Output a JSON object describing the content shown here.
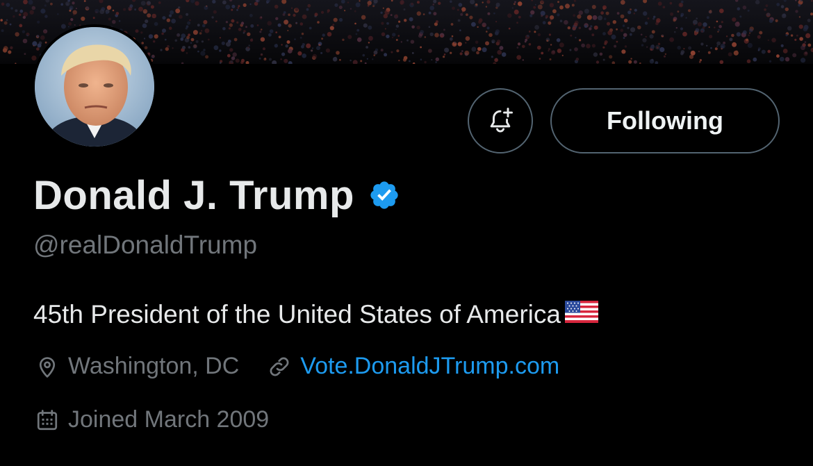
{
  "profile": {
    "display_name": "Donald J. Trump",
    "handle": "@realDonaldTrump",
    "bio": "45th President of the United States of America",
    "bio_emoji": "flag-us-icon",
    "location": "Washington, DC",
    "website": "Vote.DonaldJTrump.com",
    "joined": "Joined March 2009",
    "verified": true
  },
  "actions": {
    "follow_label": "Following",
    "notify_icon": "bell-plus-icon"
  },
  "icons": {
    "location": "map-pin-icon",
    "link": "link-icon",
    "calendar": "calendar-icon",
    "verified": "verified-badge-icon"
  },
  "colors": {
    "background": "#000000",
    "text_primary": "#e7e9ea",
    "text_secondary": "#71767b",
    "link": "#1d9bf0",
    "verified": "#1d9bf0",
    "border": "#536471"
  }
}
